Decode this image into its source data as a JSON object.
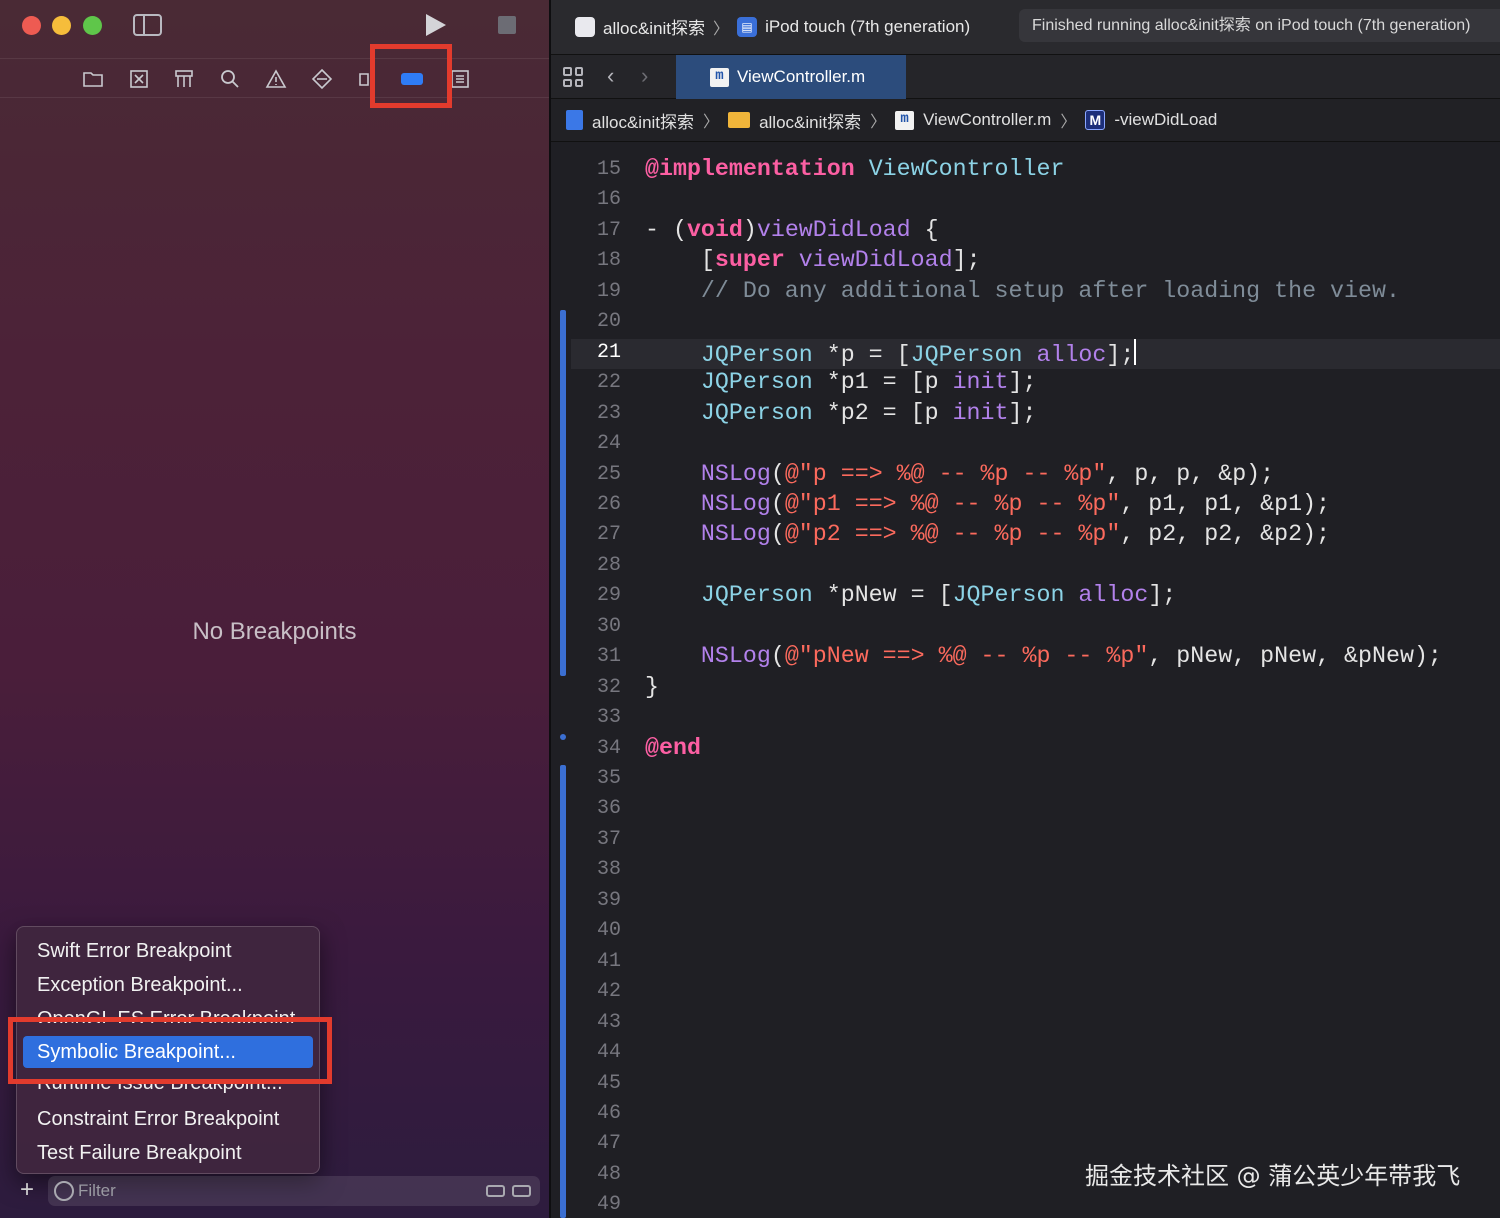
{
  "window": {
    "scheme_project": "alloc&init探索",
    "scheme_device": "iPod touch (7th generation)",
    "status": "Finished running alloc&init探索 on iPod touch (7th generation)"
  },
  "navigator": {
    "empty_state": "No Breakpoints",
    "filter_placeholder": "Filter",
    "add_button": "+",
    "menu_items": [
      "Swift Error Breakpoint",
      "Exception Breakpoint...",
      "OpenGL ES Error Breakpoint",
      "Symbolic Breakpoint...",
      "Runtime Issue Breakpoint...",
      "Constraint Error Breakpoint",
      "Test Failure Breakpoint"
    ],
    "selected_item": "Symbolic Breakpoint..."
  },
  "editor": {
    "tab_label": "ViewController.m",
    "jumpbar": {
      "project": "alloc&init探索",
      "group": "alloc&init探索",
      "file": "ViewController.m",
      "symbol": "-viewDidLoad"
    },
    "current_line": "21",
    "lines": [
      {
        "n": "15",
        "code": "@implementation ViewController"
      },
      {
        "n": "16",
        "code": ""
      },
      {
        "n": "17",
        "code": "- (void)viewDidLoad {"
      },
      {
        "n": "18",
        "code": "    [super viewDidLoad];"
      },
      {
        "n": "19",
        "code": "    // Do any additional setup after loading the view."
      },
      {
        "n": "20",
        "code": ""
      },
      {
        "n": "21",
        "code": "    JQPerson *p = [JQPerson alloc];"
      },
      {
        "n": "22",
        "code": "    JQPerson *p1 = [p init];"
      },
      {
        "n": "23",
        "code": "    JQPerson *p2 = [p init];"
      },
      {
        "n": "24",
        "code": ""
      },
      {
        "n": "25",
        "code": "    NSLog(@\"p ==> %@ -- %p -- %p\", p, p, &p);"
      },
      {
        "n": "26",
        "code": "    NSLog(@\"p1 ==> %@ -- %p -- %p\", p1, p1, &p1);"
      },
      {
        "n": "27",
        "code": "    NSLog(@\"p2 ==> %@ -- %p -- %p\", p2, p2, &p2);"
      },
      {
        "n": "28",
        "code": ""
      },
      {
        "n": "29",
        "code": "    JQPerson *pNew = [JQPerson alloc];"
      },
      {
        "n": "30",
        "code": ""
      },
      {
        "n": "31",
        "code": "    NSLog(@\"pNew ==> %@ -- %p -- %p\", pNew, pNew, &pNew);"
      },
      {
        "n": "32",
        "code": "}"
      },
      {
        "n": "33",
        "code": ""
      },
      {
        "n": "34",
        "code": "@end"
      },
      {
        "n": "35",
        "code": ""
      },
      {
        "n": "36",
        "code": ""
      },
      {
        "n": "37",
        "code": ""
      },
      {
        "n": "38",
        "code": ""
      },
      {
        "n": "39",
        "code": ""
      },
      {
        "n": "40",
        "code": ""
      },
      {
        "n": "41",
        "code": ""
      },
      {
        "n": "42",
        "code": ""
      },
      {
        "n": "43",
        "code": ""
      },
      {
        "n": "44",
        "code": ""
      },
      {
        "n": "45",
        "code": ""
      },
      {
        "n": "46",
        "code": ""
      },
      {
        "n": "47",
        "code": ""
      },
      {
        "n": "48",
        "code": ""
      },
      {
        "n": "49",
        "code": ""
      }
    ]
  },
  "watermark": "掘金技术社区 @ 蒲公英少年带我飞",
  "colors": {
    "accent": "#2f6fde",
    "annotation_red": "#e23b2d",
    "keyword": "#fc5fa3",
    "string": "#fc6a5d",
    "class": "#8cd3e6",
    "method": "#b281eb",
    "comment": "#7f8c98"
  },
  "icons": {
    "traffic_lights": [
      "close",
      "minimize",
      "zoom"
    ],
    "navigator_tabs": [
      "folder-icon",
      "source-control-icon",
      "symbol-icon",
      "search-icon",
      "warning-icon",
      "test-icon",
      "debug-icon",
      "breakpoint-icon",
      "report-icon"
    ]
  }
}
